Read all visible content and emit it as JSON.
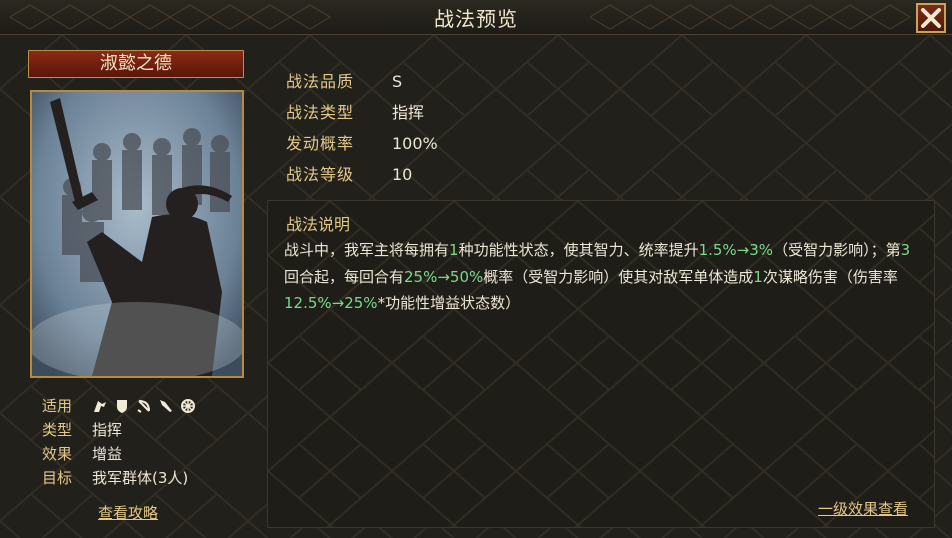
{
  "window": {
    "title": "战法预览",
    "close_icon": "close-icon"
  },
  "tactic": {
    "name": "淑懿之德",
    "labels": {
      "applies": "适用",
      "type": "类型",
      "effect": "效果",
      "target": "目标"
    },
    "type": "指挥",
    "effect": "增益",
    "target": "我军群体(3人)",
    "unit_icons": [
      "cavalry-icon",
      "shield-icon",
      "archer-icon",
      "spear-icon",
      "siege-icon"
    ],
    "guide_link": "查看攻略"
  },
  "info": {
    "quality_label": "战法品质",
    "quality": "S",
    "type_label": "战法类型",
    "type": "指挥",
    "rate_label": "发动概率",
    "rate": "100%",
    "level_label": "战法等级",
    "level": "10"
  },
  "description": {
    "heading": "战法说明",
    "segments": [
      {
        "text": "战斗中，我军主将每拥有",
        "hl": false
      },
      {
        "text": "1",
        "hl": true
      },
      {
        "text": "种功能性状态，使其智力、统率提升",
        "hl": false
      },
      {
        "text": "1.5%→3%",
        "hl": true
      },
      {
        "text": "（受智力影响）；第",
        "hl": false
      },
      {
        "text": "3",
        "hl": true
      },
      {
        "text": "回合起，每回合有",
        "hl": false
      },
      {
        "text": "25%→50%",
        "hl": true
      },
      {
        "text": "概率（受智力影响）使其对敌军单体造成",
        "hl": false
      },
      {
        "text": "1",
        "hl": true
      },
      {
        "text": "次谋略伤害（伤害率",
        "hl": false
      },
      {
        "text": "12.5%→25%",
        "hl": true
      },
      {
        "text": "*功能性增益状态数）",
        "hl": false
      }
    ],
    "effect_link": "一级效果查看"
  },
  "colors": {
    "accent_gold": "#e2c889",
    "highlight_green": "#7cd88a",
    "name_red": "#8a2a15"
  }
}
